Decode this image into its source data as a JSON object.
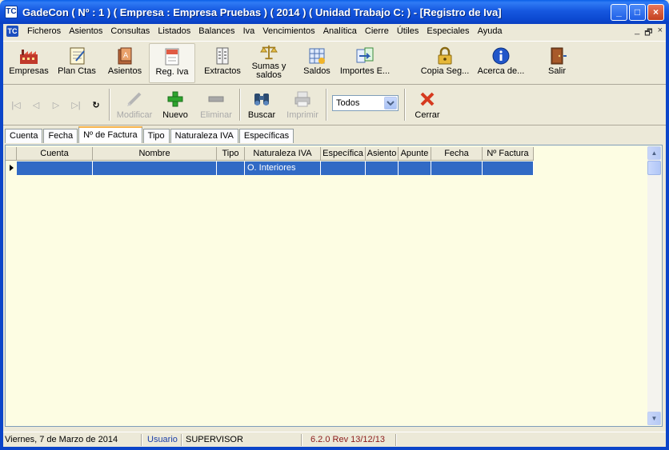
{
  "window": {
    "title": "GadeCon ( Nº : 1 ) ( Empresa : Empresa Pruebas ) ( 2014 ) ( Unidad Trabajo C: ) - [Registro de Iva]",
    "app_icon": "TC",
    "buttons": {
      "minimize": "_",
      "maximize": "□",
      "close": "×"
    }
  },
  "menu": {
    "icon": "TC",
    "items": [
      "Ficheros",
      "Asientos",
      "Consultas",
      "Listados",
      "Balances",
      "Iva",
      "Vencimientos",
      "Analítica",
      "Cierre",
      "Útiles",
      "Especiales",
      "Ayuda"
    ],
    "mdi": {
      "minimize": "_",
      "restore": "🗗",
      "close": "×"
    }
  },
  "main_toolbar": {
    "items": [
      {
        "label": "Empresas",
        "icon": "factory-icon"
      },
      {
        "label": "Plan Ctas",
        "icon": "notebook-icon"
      },
      {
        "label": "Asientos",
        "icon": "journal-icon"
      },
      {
        "label": "Reg. Iva",
        "icon": "vat-register-icon",
        "active": true
      },
      {
        "label": "Extractos",
        "icon": "ledger-icon"
      },
      {
        "label": "Sumas y saldos",
        "icon": "scales-icon"
      },
      {
        "label": "Saldos",
        "icon": "spreadsheet-icon"
      },
      {
        "label": "Importes E...",
        "icon": "import-icon"
      },
      {
        "label": "Copia Seg...",
        "icon": "lock-icon"
      },
      {
        "label": "Acerca de...",
        "icon": "info-icon"
      },
      {
        "label": "Salir",
        "icon": "exit-door-icon"
      }
    ]
  },
  "action_toolbar": {
    "nav": [
      "|◁",
      "◁",
      "▷",
      "▷|",
      "↻"
    ],
    "modify_label": "Modificar",
    "new_label": "Nuevo",
    "delete_label": "Eliminar",
    "search_label": "Buscar",
    "print_label": "Imprimir",
    "filter_value": "Todos",
    "close_label": "Cerrar"
  },
  "tabs": [
    "Cuenta",
    "Fecha",
    "Nº de Factura",
    "Tipo",
    "Naturaleza IVA",
    "Específicas"
  ],
  "active_tab": "Nº de Factura",
  "grid": {
    "columns": [
      "Cuenta",
      "Nombre",
      "Tipo",
      "Naturaleza IVA",
      "Específica",
      "Asiento",
      "Apunte",
      "Fecha",
      "Nº Factura"
    ],
    "rows": [
      [
        "",
        "",
        "",
        "O. Interiores",
        "",
        "",
        "",
        "",
        ""
      ]
    ]
  },
  "status": {
    "date": "Viernes,  7 de Marzo de 2014",
    "user_label": "Usuario",
    "user": "SUPERVISOR",
    "version": "6.2.0 Rev 13/12/13"
  },
  "colors": {
    "titlebar": "#0c49d1",
    "grid_background": "#fdfde3",
    "selection": "#316ac5",
    "delete_icon": "#d63a1f",
    "new_icon": "#2ea52e"
  }
}
